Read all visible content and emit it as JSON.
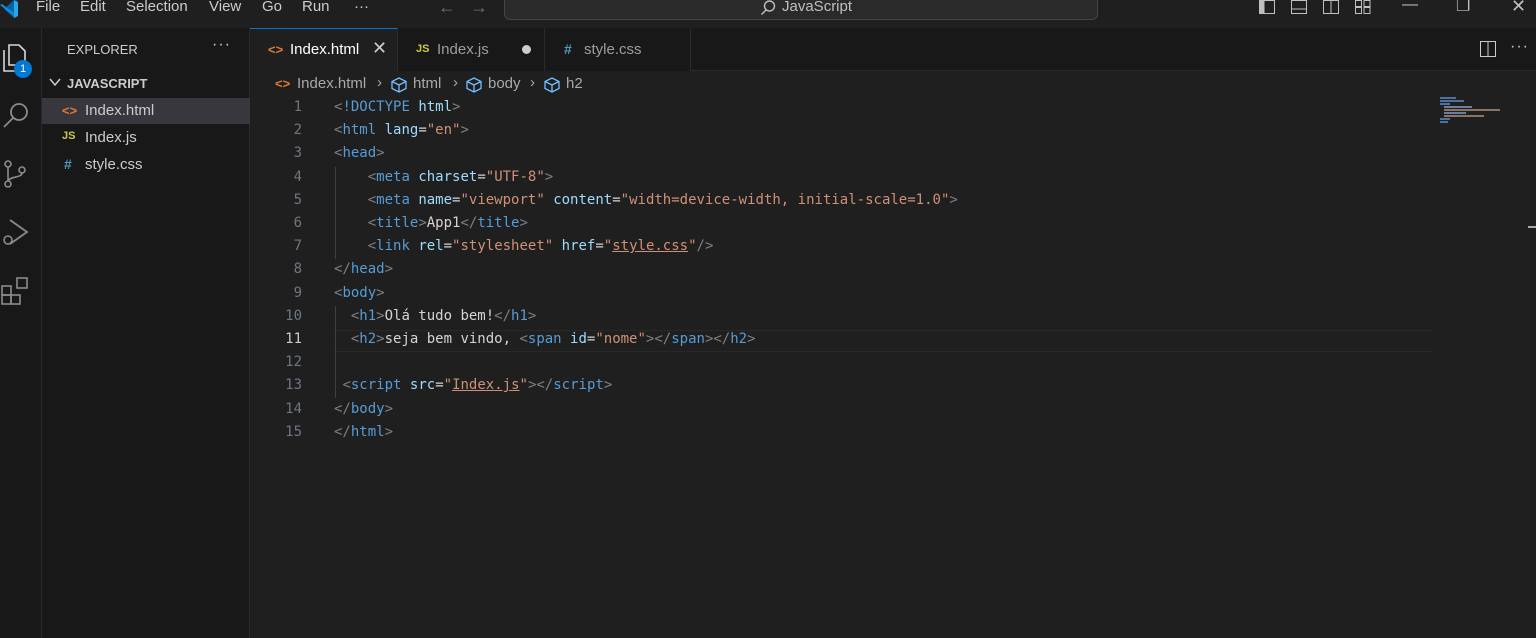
{
  "menu": [
    "File",
    "Edit",
    "Selection",
    "View",
    "Go",
    "Run",
    "···"
  ],
  "command_center": {
    "label": "JavaScript",
    "icon": "search-icon"
  },
  "activity_badge": "1",
  "explorer": {
    "title": "EXPLORER",
    "more": "···",
    "folder": "JAVASCRIPT",
    "files": [
      {
        "icon": "<>",
        "name": "Index.html",
        "icon_color": "#e37933"
      },
      {
        "icon": "JS",
        "name": "Index.js",
        "icon_color": "#cbcb41"
      },
      {
        "icon": "#",
        "name": "style.css",
        "icon_color": "#519aba"
      }
    ]
  },
  "tabs": [
    {
      "icon": "<>",
      "label": "Index.html",
      "state": "close"
    },
    {
      "icon": "JS",
      "label": "Index.js",
      "state": "modified"
    },
    {
      "icon": "#",
      "label": "style.css",
      "state": ""
    }
  ],
  "breadcrumb": [
    "Index.html",
    "html",
    "body",
    "h2"
  ],
  "current_line": 11,
  "code": [
    [
      [
        "br",
        "<"
      ],
      [
        "tag",
        "!DOCTYPE"
      ],
      [
        "txt",
        " "
      ],
      [
        "attr",
        "html"
      ],
      [
        "br",
        ">"
      ]
    ],
    [
      [
        "br",
        "<"
      ],
      [
        "tag",
        "html"
      ],
      [
        "txt",
        " "
      ],
      [
        "attr",
        "lang"
      ],
      [
        "txt",
        "="
      ],
      [
        "str",
        "\"en\""
      ],
      [
        "br",
        ">"
      ]
    ],
    [
      [
        "br",
        "<"
      ],
      [
        "tag",
        "head"
      ],
      [
        "br",
        ">"
      ]
    ],
    [
      [
        "txt",
        "    "
      ],
      [
        "br",
        "<"
      ],
      [
        "tag",
        "meta"
      ],
      [
        "txt",
        " "
      ],
      [
        "attr",
        "charset"
      ],
      [
        "txt",
        "="
      ],
      [
        "str",
        "\"UTF-8\""
      ],
      [
        "br",
        ">"
      ]
    ],
    [
      [
        "txt",
        "    "
      ],
      [
        "br",
        "<"
      ],
      [
        "tag",
        "meta"
      ],
      [
        "txt",
        " "
      ],
      [
        "attr",
        "name"
      ],
      [
        "txt",
        "="
      ],
      [
        "str",
        "\"viewport\""
      ],
      [
        "txt",
        " "
      ],
      [
        "attr",
        "content"
      ],
      [
        "txt",
        "="
      ],
      [
        "str",
        "\"width=device-width, initial-scale=1.0\""
      ],
      [
        "br",
        ">"
      ]
    ],
    [
      [
        "txt",
        "    "
      ],
      [
        "br",
        "<"
      ],
      [
        "tag",
        "title"
      ],
      [
        "br",
        ">"
      ],
      [
        "txt",
        "App1"
      ],
      [
        "br",
        "</"
      ],
      [
        "tag",
        "title"
      ],
      [
        "br",
        ">"
      ]
    ],
    [
      [
        "txt",
        "    "
      ],
      [
        "br",
        "<"
      ],
      [
        "tag",
        "link"
      ],
      [
        "txt",
        " "
      ],
      [
        "attr",
        "rel"
      ],
      [
        "txt",
        "="
      ],
      [
        "str",
        "\"stylesheet\""
      ],
      [
        "txt",
        " "
      ],
      [
        "attr",
        "href"
      ],
      [
        "txt",
        "="
      ],
      [
        "str",
        "\""
      ],
      [
        "link",
        "style.css"
      ],
      [
        "str",
        "\""
      ],
      [
        "br",
        "/>"
      ]
    ],
    [
      [
        "br",
        "</"
      ],
      [
        "tag",
        "head"
      ],
      [
        "br",
        ">"
      ]
    ],
    [
      [
        "br",
        "<"
      ],
      [
        "tag",
        "body"
      ],
      [
        "br",
        ">"
      ]
    ],
    [
      [
        "txt",
        "  "
      ],
      [
        "br",
        "<"
      ],
      [
        "tag",
        "h1"
      ],
      [
        "br",
        ">"
      ],
      [
        "txt",
        "Olá tudo bem!"
      ],
      [
        "br",
        "</"
      ],
      [
        "tag",
        "h1"
      ],
      [
        "br",
        ">"
      ]
    ],
    [
      [
        "txt",
        "  "
      ],
      [
        "br",
        "<"
      ],
      [
        "tag",
        "h2"
      ],
      [
        "br",
        ">"
      ],
      [
        "txt",
        "seja bem vindo, "
      ],
      [
        "br",
        "<"
      ],
      [
        "tag",
        "span"
      ],
      [
        "txt",
        " "
      ],
      [
        "attr",
        "id"
      ],
      [
        "txt",
        "="
      ],
      [
        "str",
        "\"nome\""
      ],
      [
        "br",
        "></"
      ],
      [
        "tag",
        "span"
      ],
      [
        "br",
        "></"
      ],
      [
        "tag",
        "h2"
      ],
      [
        "br",
        ">"
      ]
    ],
    [],
    [
      [
        "txt",
        " "
      ],
      [
        "br",
        "<"
      ],
      [
        "tag",
        "script"
      ],
      [
        "txt",
        " "
      ],
      [
        "attr",
        "src"
      ],
      [
        "txt",
        "="
      ],
      [
        "str",
        "\""
      ],
      [
        "link",
        "Index.js"
      ],
      [
        "str",
        "\""
      ],
      [
        "br",
        "></"
      ],
      [
        "tag",
        "script"
      ],
      [
        "br",
        ">"
      ]
    ],
    [
      [
        "br",
        "</"
      ],
      [
        "tag",
        "body"
      ],
      [
        "br",
        ">"
      ]
    ],
    [
      [
        "br",
        "</"
      ],
      [
        "tag",
        "html"
      ],
      [
        "br",
        ">"
      ]
    ]
  ]
}
